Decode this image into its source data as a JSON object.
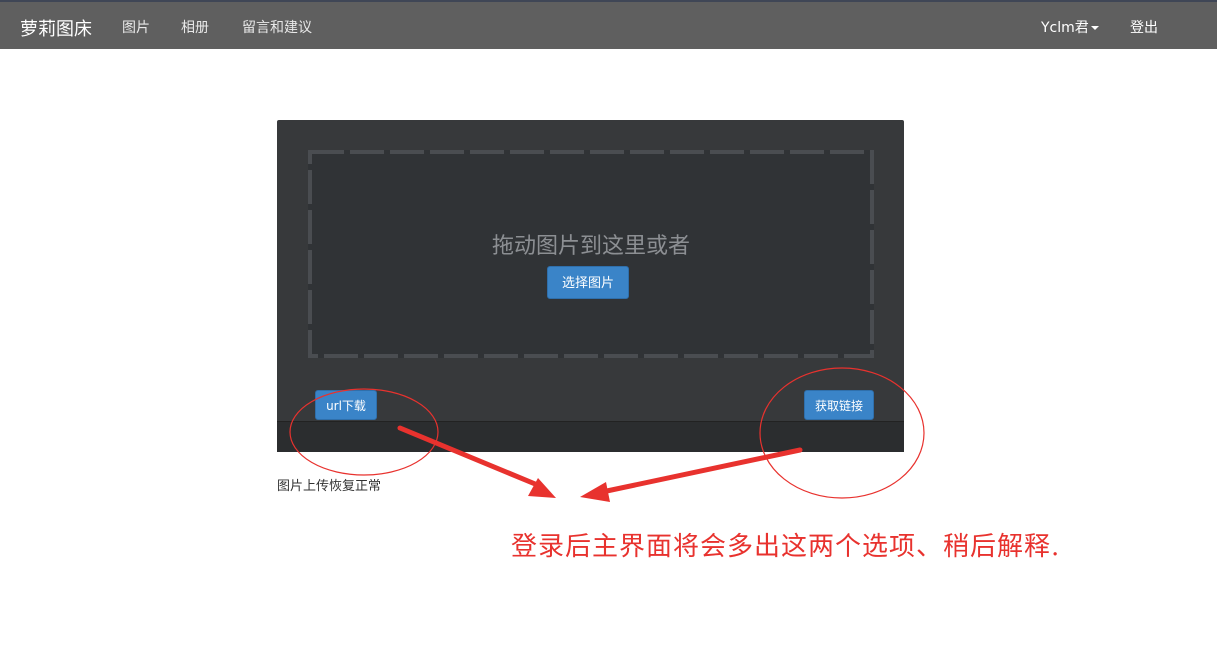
{
  "header": {
    "brand": "萝莉图床",
    "nav": [
      "图片",
      "相册",
      "留言和建议"
    ],
    "user": "Yclm君",
    "logout": "登出"
  },
  "upload": {
    "drop_text": "拖动图片到这里或者",
    "select_button": "选择图片",
    "url_download_button": "url下载",
    "get_link_button": "获取链接"
  },
  "status": "图片上传恢复正常",
  "annotation": {
    "text": "登录后主界面将会多出这两个选项、稍后解释."
  },
  "colors": {
    "navbar": "#5f5f5f",
    "panel": "#37393b",
    "button": "#3a84c8",
    "annotation": "#e8322e"
  }
}
